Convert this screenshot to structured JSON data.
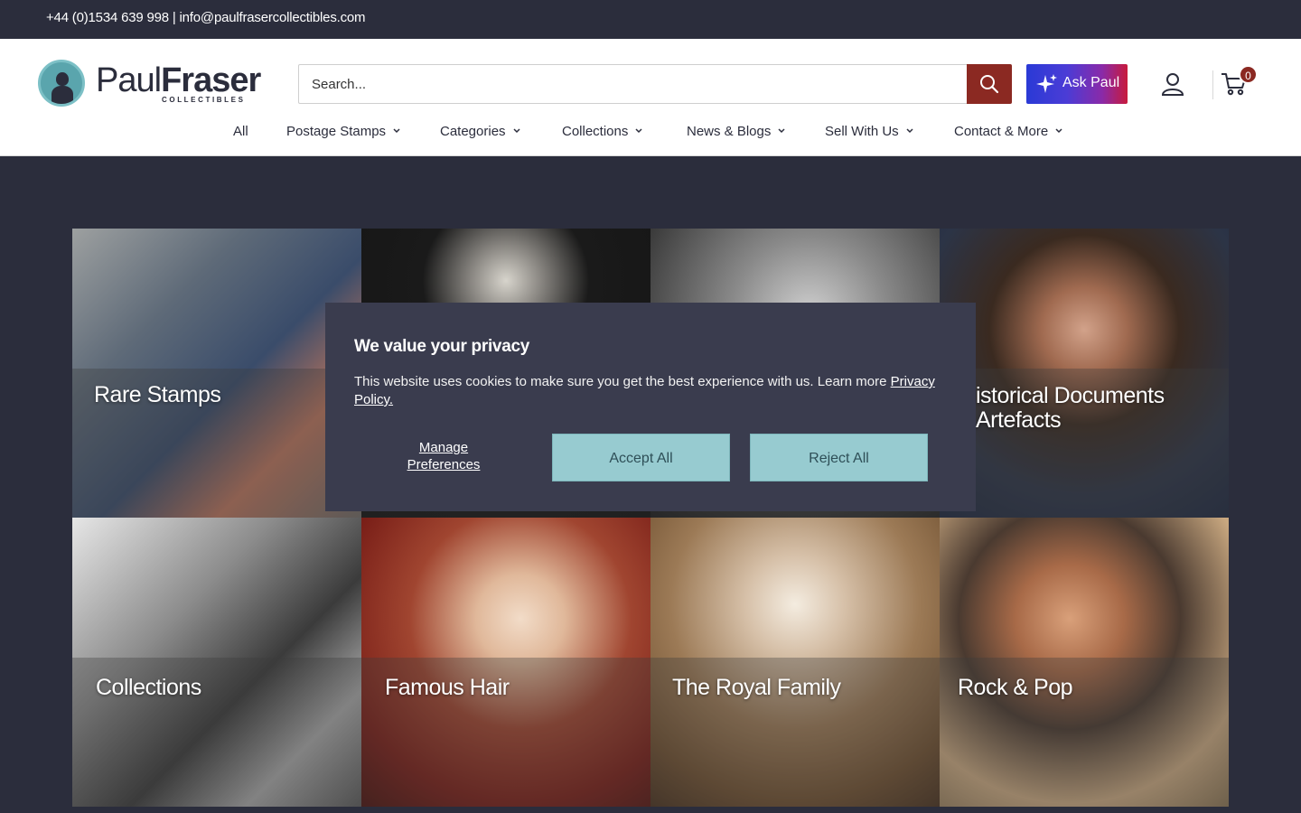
{
  "topbar": {
    "contact": "+44 (0)1534 639 998 | info@paulfrasercollectibles.com"
  },
  "logo": {
    "name_part1": "Paul",
    "name_part2": "Fraser",
    "subtitle": "COLLECTIBLES"
  },
  "search": {
    "placeholder": "Search..."
  },
  "ask_paul": {
    "label": "Ask Paul"
  },
  "cart": {
    "count": "0"
  },
  "nav": [
    {
      "label": "All"
    },
    {
      "label": "Postage Stamps"
    },
    {
      "label": "Categories"
    },
    {
      "label": "Collections"
    },
    {
      "label": "News & Blogs"
    },
    {
      "label": "Sell With Us"
    },
    {
      "label": "Contact & More"
    }
  ],
  "tiles": [
    {
      "label": "Rare Stamps"
    },
    {
      "label": ""
    },
    {
      "label": ""
    },
    {
      "label": "istorical Documents\n Artefacts"
    },
    {
      "label": "Collections"
    },
    {
      "label": "Famous Hair"
    },
    {
      "label": "The Royal Family"
    },
    {
      "label": "Rock & Pop"
    }
  ],
  "cookie": {
    "title": "We value your privacy",
    "message": "This website uses cookies to make sure you get the best experience with us. Learn more",
    "policy_link": "Privacy Policy.",
    "manage_line1": "Manage",
    "manage_line2": "Preferences",
    "accept": "Accept All",
    "reject": "Reject All"
  },
  "colors": {
    "dark": "#2b2d3c",
    "brand_red": "#8b2922",
    "cookie_bg": "#3a3c4e",
    "cookie_button": "#97cbd0"
  }
}
